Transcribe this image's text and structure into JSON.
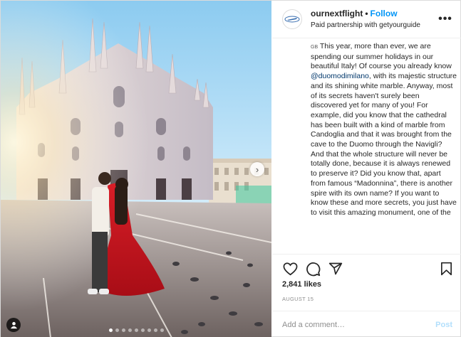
{
  "header": {
    "username": "ournextflight",
    "separator": "•",
    "follow_label": "Follow",
    "subtitle": "Paid partnership with getyourguide",
    "more_label": "•••"
  },
  "caption": {
    "flag": "GB",
    "text_before_mention": " This year, more than ever, we are spending our summer holidays in our beautiful Italy! Of course you already know ",
    "mention": "@duomodimilano",
    "text_after_mention": ", with its majestic structure and its shining white marble. Anyway, most of its secrets haven't surely been discovered yet for many of you! For example, did you know that the cathedral has been built with a kind of marble from Candoglia and that it was brought from the cave to the Duomo through the Navigli? And that the whole structure will never be totally done, because it is always renewed to preserve it? Did you know that, apart from famous “Madonnina”, there is another spire with its own name? If you want to know these and more secrets, you just have to visit this amazing monument, one of the"
  },
  "actions": {
    "like_icon": "heart-icon",
    "comment_icon": "comment-icon",
    "share_icon": "share-icon",
    "save_icon": "bookmark-icon"
  },
  "likes_text": "2,841 likes",
  "date_text": "AUGUST 15",
  "comment": {
    "placeholder": "Add a comment…",
    "post_label": "Post"
  },
  "carousel": {
    "slide_count": 9,
    "active_index": 0,
    "next_icon": "chevron-right-icon",
    "tag_icon": "user-tag-icon"
  },
  "colors": {
    "follow_blue": "#0095f6",
    "mention_blue": "#00376b",
    "post_disabled": "#b2dffc",
    "dress_red": "#c8141e"
  }
}
